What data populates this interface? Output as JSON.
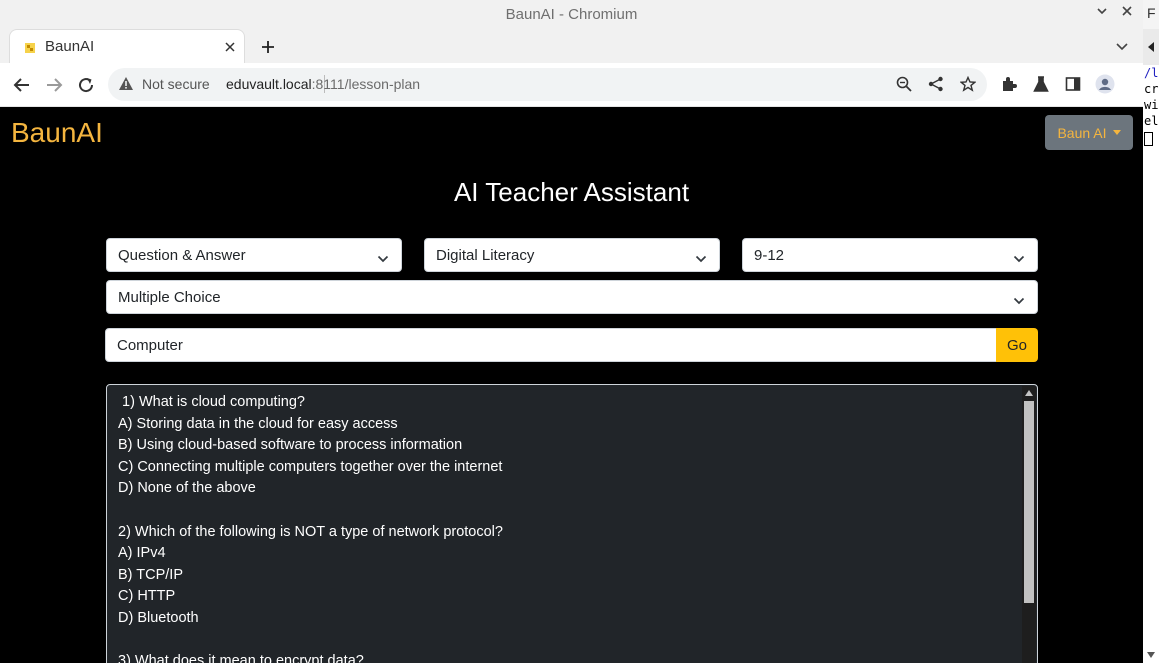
{
  "window": {
    "title": "BaunAI - Chromium"
  },
  "tab": {
    "label": "BaunAI"
  },
  "address_bar": {
    "security_label": "Not secure",
    "url_host": "eduvault.local",
    "url_rest": ":8111/lesson-plan"
  },
  "navbar": {
    "brand": "BaunAI",
    "user_menu": "Baun AI"
  },
  "main": {
    "heading": "AI Teacher Assistant",
    "selects": {
      "activity_type": "Question & Answer",
      "subject": "Digital Literacy",
      "grade": "9-12",
      "question_format": "Multiple Choice"
    },
    "topic_input": "Computer",
    "go_label": "Go",
    "output_text": " 1) What is cloud computing?\nA) Storing data in the cloud for easy access\nB) Using cloud-based software to process information\nC) Connecting multiple computers together over the internet\nD) None of the above\n\n2) Which of the following is NOT a type of network protocol?\nA) IPv4\nB) TCP/IP\nC) HTTP\nD) Bluetooth\n\n3) What does it mean to encrypt data?"
  },
  "side_window": {
    "title_char": "F",
    "terminal_lines": [
      "/l",
      "cr",
      "wi",
      "el"
    ]
  },
  "colors": {
    "accent": "#f4b53f",
    "go_button": "#ffc107",
    "page_bg": "#000000",
    "output_bg": "#212529",
    "user_menu_bg": "#6c757d"
  },
  "icons": [
    "chevron-down-icon",
    "close-icon",
    "plus-icon",
    "back-icon",
    "forward-icon",
    "reload-icon",
    "warning-icon",
    "zoom-icon",
    "share-icon",
    "star-icon",
    "extensions-icon",
    "lab-icon",
    "sidepanel-icon",
    "profile-icon",
    "menu-icon",
    "caret-down-icon"
  ]
}
